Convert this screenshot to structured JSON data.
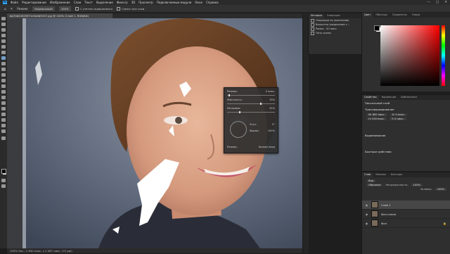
{
  "app": {
    "logo": "Ps"
  },
  "menu": [
    "Файл",
    "Редактирование",
    "Изображение",
    "Слои",
    "Текст",
    "Выделение",
    "Фильтр",
    "3D",
    "Просмотр",
    "Подключаемые модули",
    "Окно",
    "Справка"
  ],
  "options": {
    "mode_label": "Режим:",
    "mode_value": "Нормальный",
    "opacity": "100%",
    "check1": "С учетом содержимого",
    "check2": "Сэмпл: все слои"
  },
  "document": {
    "tab_title": "bb70b54529971e3a0b9107.jpg @ 100% (Слой 1, RGB/8#)",
    "status": "100%   Экс.: 1 600 пикс. x 1 067 пикс. (72 ppi)"
  },
  "history_panel": {
    "tabs": [
      "История",
      "Операции"
    ],
    "items": [
      "Операции по умолчанию",
      "Виньетка (выделение с...",
      "Рамка - 50 пикс.",
      "Тень сцены"
    ]
  },
  "color_panel": {
    "tabs": [
      "Цвет",
      "Образцы",
      "Градиенты",
      "Узоры"
    ]
  },
  "properties_panel": {
    "tabs": [
      "Свойства",
      "Коррекция",
      "Библиотеки"
    ],
    "layer_kind": "Пиксельный слой",
    "transform_label": "Трансформирование",
    "w": "W: 800 пикс.",
    "h": "H: 533 пикс.",
    "x": "X: 0 пикс.",
    "y": "Y: 0 пикс.",
    "align_label": "Выравнивание",
    "quick_actions": "Быстрые действия"
  },
  "layers_panel": {
    "tabs": [
      "Слои",
      "Каналы",
      "Контуры"
    ],
    "kind": "Вид",
    "blend": "Обычные",
    "opacity_label": "Непрозрачность:",
    "opacity": "100%",
    "fill_label": "Заливка:",
    "fill": "100%",
    "layers": [
      "Слой 1",
      "Фон копия",
      "Фон"
    ]
  },
  "liquify_dialog": {
    "rows": [
      {
        "label": "Размер:",
        "value": "0 пикс."
      },
      {
        "label": "Жесткость:",
        "value": "70%"
      },
      {
        "label": "Интервал:",
        "value": "25%"
      }
    ],
    "angle_label": "Угол:",
    "angle": "0°",
    "roundness_label": "Форма:",
    "roundness": "100%",
    "size_label": "Размер:",
    "size_mode": "Нажим пера"
  },
  "colors": {
    "accent": "#31a8ff"
  }
}
